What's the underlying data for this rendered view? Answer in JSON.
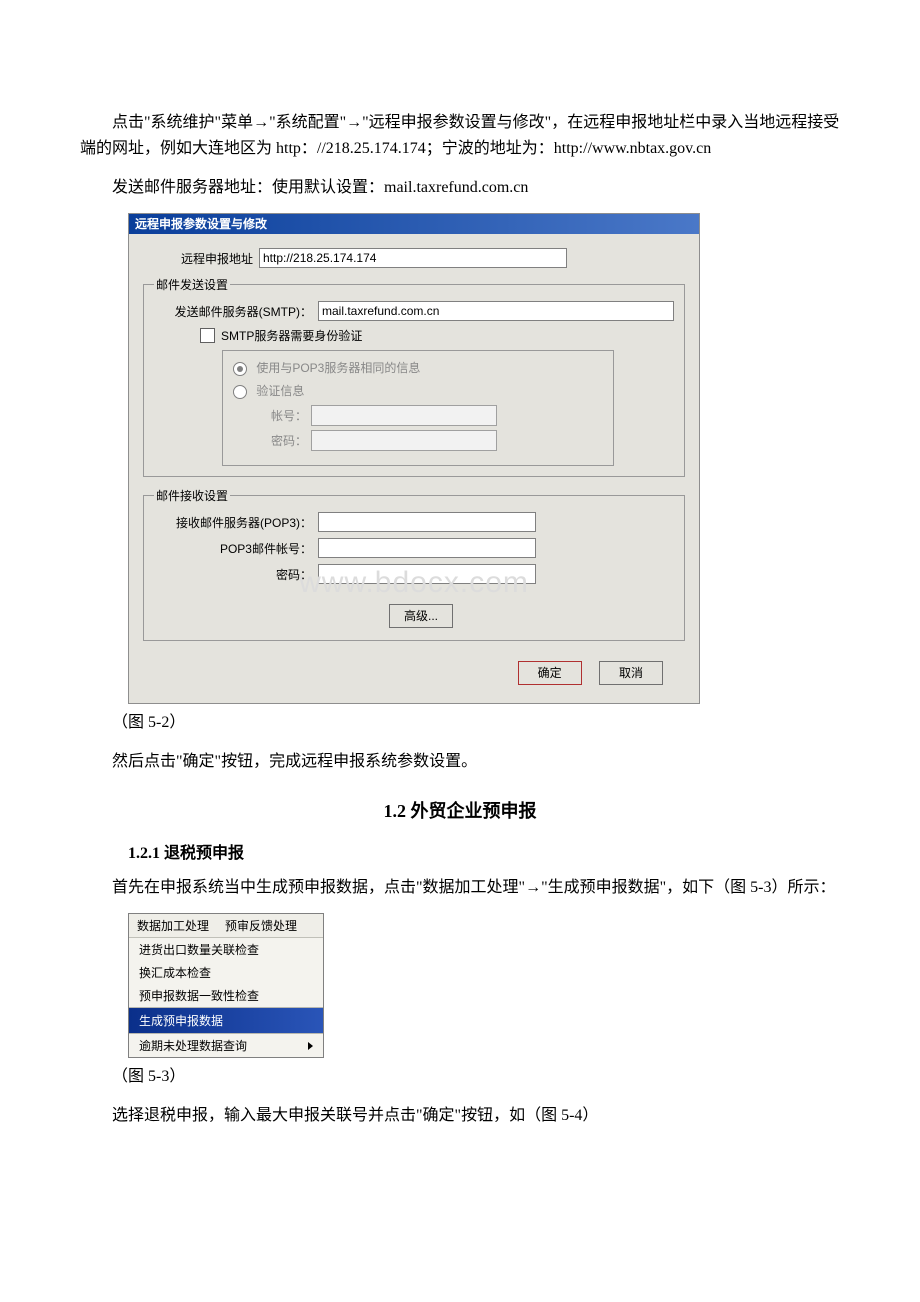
{
  "para1": "点击\"系统维护\"菜单→\"系统配置\"→\"远程申报参数设置与修改\"，在远程申报地址栏中录入当地远程接受端的网址，例如大连地区为 http：//218.25.174.174；宁波的地址为：http://www.nbtax.gov.cn",
  "para2": "发送邮件服务器地址：使用默认设置：mail.taxrefund.com.cn",
  "dialog": {
    "title": "远程申报参数设置与修改",
    "remote_label": "远程申报地址",
    "remote_value": "http://218.25.174.174",
    "send_legend": "邮件发送设置",
    "smtp_label": "发送邮件服务器(SMTP)：",
    "smtp_value": "mail.taxrefund.com.cn",
    "smtp_auth_label": "SMTP服务器需要身份验证",
    "radio_same": "使用与POP3服务器相同的信息",
    "radio_verify": "验证信息",
    "acct_label": "帐号：",
    "pwd_label": "密码：",
    "recv_legend": "邮件接收设置",
    "pop3_label": "接收邮件服务器(POP3)：",
    "pop3_acct_label": "POP3邮件帐号：",
    "pop3_pwd_label": "密码：",
    "advanced": "高级...",
    "ok": "确定",
    "cancel": "取消"
  },
  "watermark": "www.bdocx.com",
  "fig52": "（图 5-2）",
  "para3": "然后点击\"确定\"按钮，完成远程申报系统参数设置。",
  "sec12": "1.2 外贸企业预申报",
  "sec121": "1.2.1 退税预申报",
  "para4": "首先在申报系统当中生成预申报数据，点击\"数据加工处理\"→\"生成预申报数据\"，如下（图 5-3）所示：",
  "menu": {
    "head1": "数据加工处理",
    "head2": "预审反馈处理",
    "item1": "进货出口数量关联检查",
    "item2": "换汇成本检查",
    "item3": "预申报数据一致性检查",
    "item4": "生成预申报数据",
    "item5": "逾期未处理数据查询"
  },
  "fig53": "（图 5-3）",
  "para5": "选择退税申报，输入最大申报关联号并点击\"确定\"按钮，如（图 5-4）"
}
